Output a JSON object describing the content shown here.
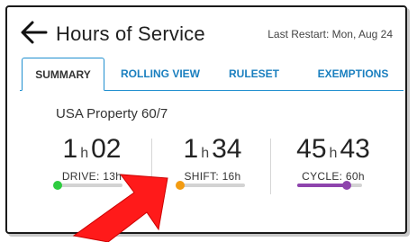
{
  "header": {
    "title": "Hours of Service",
    "last_restart": "Last Restart: Mon, Aug 24"
  },
  "tabs": [
    {
      "label": "SUMMARY",
      "active": true
    },
    {
      "label": "ROLLING VIEW",
      "active": false
    },
    {
      "label": "RULESET",
      "active": false
    },
    {
      "label": "EXEMPTIONS",
      "active": false
    }
  ],
  "ruleset_name": "USA Property 60/7",
  "metrics": [
    {
      "hours": "1",
      "unit_h": "h",
      "minutes": "02",
      "label": "DRIVE: 13h",
      "progress": 0.0,
      "color": "#2ecc40"
    },
    {
      "hours": "1",
      "unit_h": "h",
      "minutes": "34",
      "label": "SHIFT: 16h",
      "progress": 0.0,
      "color": "#f39c12"
    },
    {
      "hours": "45",
      "unit_h": "h",
      "minutes": "43",
      "label": "CYCLE: 60h",
      "progress": 0.76,
      "color": "#8e44ad"
    }
  ],
  "colors": {
    "accent": "#1f8fcf",
    "annotation_arrow": "#ff1a1a"
  },
  "icons": {
    "back": "arrow-left-icon"
  }
}
